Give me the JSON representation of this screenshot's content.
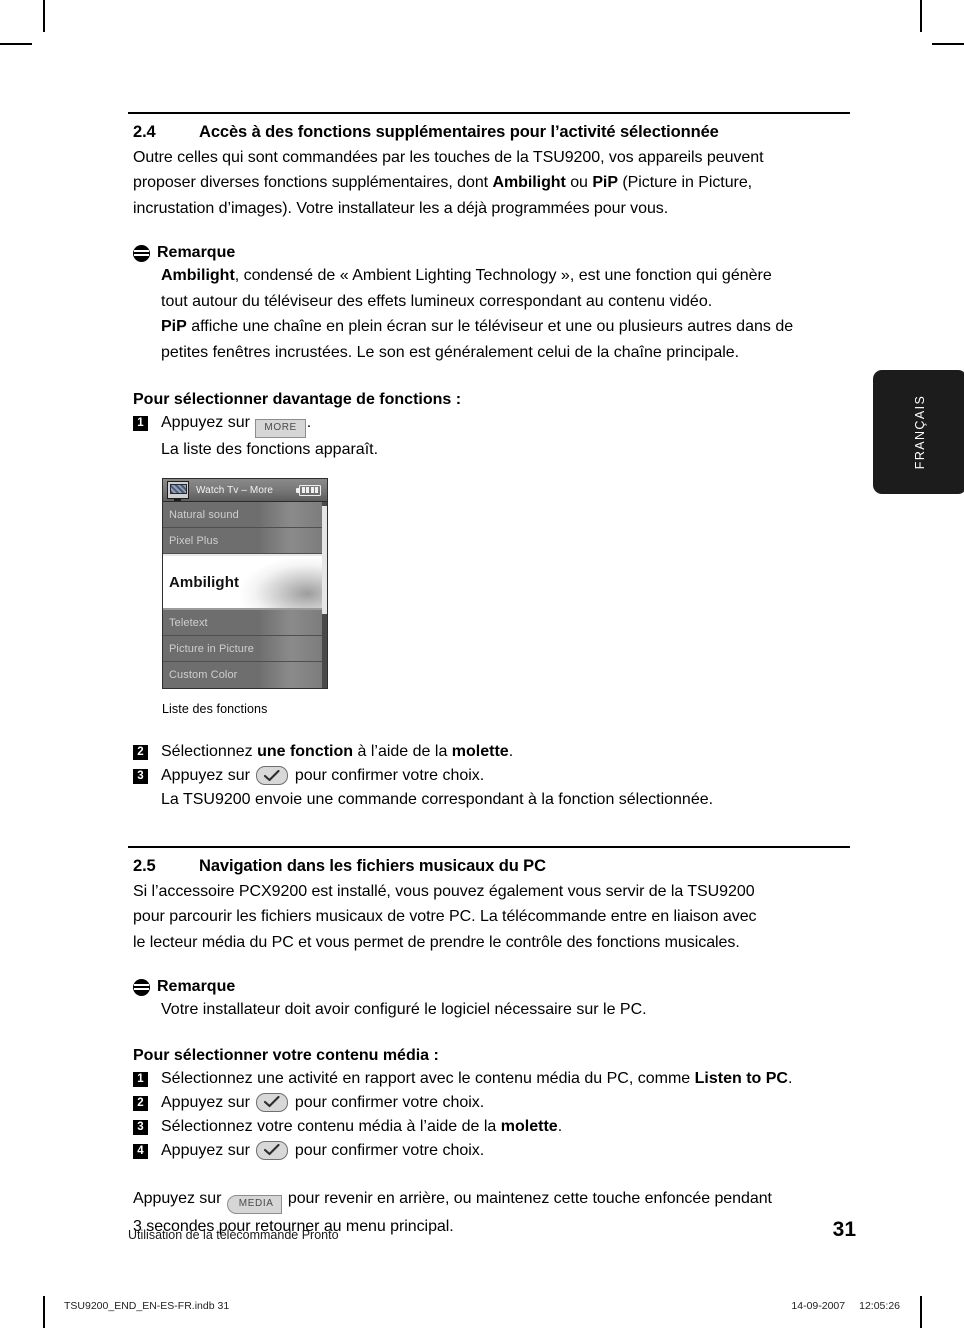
{
  "section_24": {
    "number": "2.4",
    "title": "Accès à des fonctions supplémentaires pour l’activité sélectionnée",
    "intro_l1": "Outre celles qui sont commandées par les touches de la TSU9200, vos appareils peuvent",
    "intro_l2_a": "proposer diverses fonctions supplémentaires, dont ",
    "intro_l2_b": "Ambilight",
    "intro_l2_c": " ou ",
    "intro_l2_d": "PiP",
    "intro_l2_e": " (Picture in Picture,",
    "intro_l3": "incrustation d’images). Votre installateur les a déjà programmées pour vous."
  },
  "note_1": {
    "heading": "Remarque",
    "p1_bold": "Ambilight",
    "p1_rest": ", condensé de « Ambient Lighting Technology », est une fonction qui génère",
    "p1_l2": "tout autour du téléviseur des effets lumineux correspondant au contenu vidéo.",
    "p2_bold": "PiP",
    "p2_rest": " affiche une chaîne en plein écran sur le téléviseur et une ou plusieurs autres dans de",
    "p2_l2": "petites fenêtres incrustées. Le son est généralement celui de la chaîne principale."
  },
  "procedure_1": {
    "heading": "Pour sélectionner davantage de fonctions :",
    "step1_num": "1",
    "step1_pre": "Appuyez sur ",
    "step1_key": "MORE",
    "step1_post": ".",
    "step1_sub": "La liste des fonctions apparaît.",
    "step2_num": "2",
    "step2_a": "Sélectionnez ",
    "step2_b": "une fonction",
    "step2_c": " à l’aide de la ",
    "step2_d": "molette",
    "step2_e": ".",
    "step3_num": "3",
    "step3_pre": "Appuyez sur ",
    "step3_post": " pour confirmer votre choix.",
    "step3_sub": "La TSU9200 envoie une commande correspondant à la fonction sélectionnée."
  },
  "lcd": {
    "title": "Watch Tv – More",
    "tv_icon": "tv-icon",
    "battery_icon": "battery-full-icon",
    "items": [
      {
        "label": "Natural sound",
        "selected": false
      },
      {
        "label": "Pixel Plus",
        "selected": false
      },
      {
        "label": "Ambilight",
        "selected": true
      },
      {
        "label": "Teletext",
        "selected": false
      },
      {
        "label": "Picture in Picture",
        "selected": false
      },
      {
        "label": "Custom Color",
        "selected": false
      }
    ],
    "caption": "Liste des fonctions"
  },
  "section_25": {
    "number": "2.5",
    "title": "Navigation dans les fichiers musicaux du PC",
    "intro_l1": "Si l’accessoire PCX9200 est installé, vous pouvez également vous servir de la TSU9200",
    "intro_l2": "pour parcourir les fichiers musicaux de votre PC. La télécommande entre en liaison avec",
    "intro_l3": "le lecteur média du PC et vous permet de prendre le contrôle des fonctions musicales."
  },
  "note_2": {
    "heading": "Remarque",
    "body": "Votre installateur doit avoir configuré le logiciel nécessaire sur le PC."
  },
  "procedure_2": {
    "heading": "Pour sélectionner votre contenu média :",
    "step1_num": "1",
    "step1_a": "Sélectionnez une activité en rapport avec le contenu média du PC, comme ",
    "step1_b": "Listen to PC",
    "step1_c": ".",
    "step2_num": "2",
    "step2_pre": "Appuyez sur ",
    "step2_post": " pour confirmer votre choix.",
    "step3_num": "3",
    "step3_a": "Sélectionnez votre contenu média à l’aide de la ",
    "step3_b": "molette",
    "step3_c": ".",
    "step4_num": "4",
    "step4_pre": "Appuyez sur ",
    "step4_post": " pour confirmer votre choix."
  },
  "closing": {
    "pre": "Appuyez sur ",
    "key": "MEDIA",
    "post": " pour revenir en arrière, ou maintenez cette touche enfoncée pendant",
    "line2": "3 secondes pour retourner au menu principal."
  },
  "tab": {
    "label": "FRANÇAIS"
  },
  "footer": {
    "left": "Utilisation de la télécommande Pronto",
    "page": "31"
  },
  "printline": {
    "file": "TSU9200_END_EN-ES-FR.indb   31",
    "date": "14-09-2007",
    "time": "12:05:26"
  }
}
